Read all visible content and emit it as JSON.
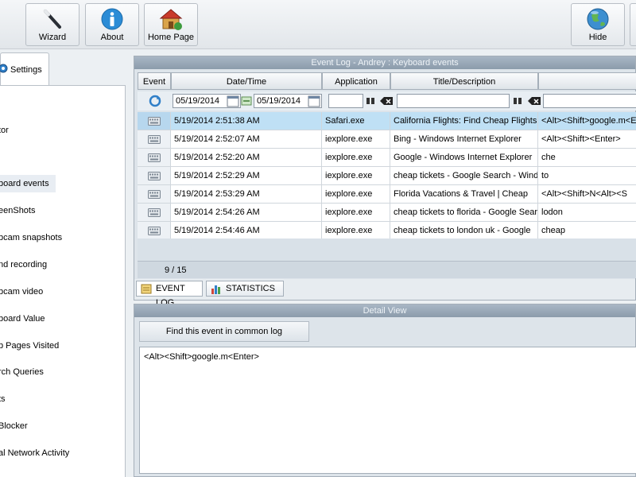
{
  "toolbar": {
    "wizard": "Wizard",
    "about": "About",
    "home_page": "Home Page",
    "hide": "Hide"
  },
  "left": {
    "tab_label": "Settings",
    "items": [
      "tor",
      "board events",
      "eenShots",
      "bcam snapshots",
      "nd recording",
      "bcam video",
      "board Value",
      "b Pages Visited",
      "rch Queries",
      "ts",
      " Blocker",
      "al Network Activity"
    ]
  },
  "event_log": {
    "title": "Event Log - Andrey : Keyboard events",
    "columns": [
      "Event",
      "Date/Time",
      "Application",
      "Title/Description",
      ""
    ],
    "filter": {
      "date_from": "05/19/2014",
      "date_to": "05/19/2014"
    },
    "rows": [
      {
        "datetime": "5/19/2014 2:51:38 AM",
        "app": "Safari.exe",
        "title": "California Flights: Find Cheap Flights",
        "value": "<Alt><Shift>google.m<Enter>",
        "selected": true
      },
      {
        "datetime": "5/19/2014 2:52:07 AM",
        "app": "iexplore.exe",
        "title": "Bing - Windows Internet Explorer",
        "value": "<Alt><Shift><Enter>",
        "selected": false
      },
      {
        "datetime": "5/19/2014 2:52:20 AM",
        "app": "iexplore.exe",
        "title": "Google - Windows Internet Explorer",
        "value": "che",
        "selected": false
      },
      {
        "datetime": "5/19/2014 2:52:29 AM",
        "app": "iexplore.exe",
        "title": "cheap tickets - Google Search - Windows",
        "value": "to",
        "selected": false
      },
      {
        "datetime": "5/19/2014 2:53:29 AM",
        "app": "iexplore.exe",
        "title": "Florida Vacations & Travel | Cheap",
        "value": "<Alt><Shift>N<Alt><S",
        "selected": false
      },
      {
        "datetime": "5/19/2014 2:54:26 AM",
        "app": "iexplore.exe",
        "title": "cheap tickets to florida - Google Search",
        "value": "lodon",
        "selected": false
      },
      {
        "datetime": "5/19/2014 2:54:46 AM",
        "app": "iexplore.exe",
        "title": "cheap tickets to london uk - Google",
        "value": "cheap",
        "selected": false
      }
    ],
    "counter": "9 / 15",
    "tabs": [
      "EVENT LOG",
      "STATISTICS"
    ]
  },
  "detail": {
    "title": "Detail View",
    "find_button": "Find this event in common log",
    "text": "<Alt><Shift>google.m<Enter>"
  }
}
